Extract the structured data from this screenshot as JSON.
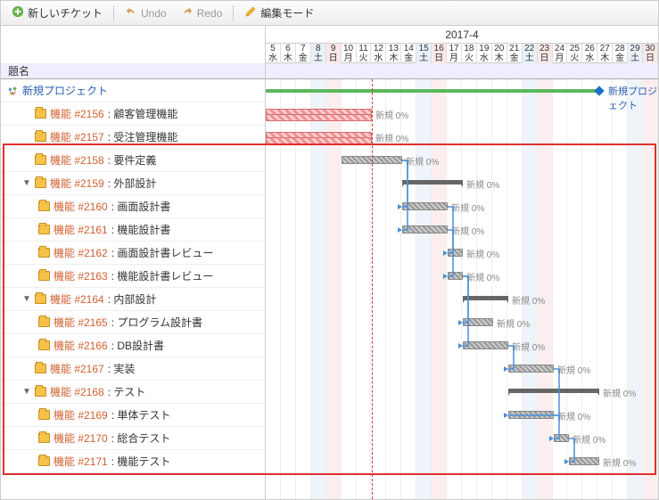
{
  "toolbar": {
    "new_ticket": "新しいチケット",
    "undo": "Undo",
    "redo": "Redo",
    "edit_mode": "編集モード"
  },
  "header": {
    "month": "2017-4",
    "subject": "題名",
    "days": [
      {
        "n": "5",
        "w": "水",
        "t": ""
      },
      {
        "n": "6",
        "w": "木",
        "t": ""
      },
      {
        "n": "7",
        "w": "金",
        "t": ""
      },
      {
        "n": "8",
        "w": "土",
        "t": "sat"
      },
      {
        "n": "9",
        "w": "日",
        "t": "sun"
      },
      {
        "n": "10",
        "w": "月",
        "t": ""
      },
      {
        "n": "11",
        "w": "火",
        "t": ""
      },
      {
        "n": "12",
        "w": "水",
        "t": ""
      },
      {
        "n": "13",
        "w": "木",
        "t": ""
      },
      {
        "n": "14",
        "w": "金",
        "t": ""
      },
      {
        "n": "15",
        "w": "土",
        "t": "sat"
      },
      {
        "n": "16",
        "w": "日",
        "t": "sun"
      },
      {
        "n": "17",
        "w": "月",
        "t": ""
      },
      {
        "n": "18",
        "w": "火",
        "t": ""
      },
      {
        "n": "19",
        "w": "水",
        "t": ""
      },
      {
        "n": "20",
        "w": "木",
        "t": ""
      },
      {
        "n": "21",
        "w": "金",
        "t": ""
      },
      {
        "n": "22",
        "w": "土",
        "t": "sat"
      },
      {
        "n": "23",
        "w": "日",
        "t": "sun"
      },
      {
        "n": "24",
        "w": "月",
        "t": ""
      },
      {
        "n": "25",
        "w": "火",
        "t": ""
      },
      {
        "n": "26",
        "w": "水",
        "t": ""
      },
      {
        "n": "27",
        "w": "木",
        "t": ""
      },
      {
        "n": "28",
        "w": "金",
        "t": ""
      },
      {
        "n": "29",
        "w": "土",
        "t": "sat"
      },
      {
        "n": "30",
        "w": "日",
        "t": "sun"
      }
    ]
  },
  "status_label": "新規 0%",
  "project_name": "新規プロジェクト",
  "tasks": [
    {
      "id": "2156",
      "label": "機能 #2156",
      "name": "顧客管理機能",
      "indent": 1,
      "expand": null
    },
    {
      "id": "2157",
      "label": "機能 #2157",
      "name": "受注管理機能",
      "indent": 1,
      "expand": null
    },
    {
      "id": "2158",
      "label": "機能 #2158",
      "name": "要件定義",
      "indent": 1,
      "expand": null
    },
    {
      "id": "2159",
      "label": "機能 #2159",
      "name": "外部設計",
      "indent": 1,
      "expand": "open"
    },
    {
      "id": "2160",
      "label": "機能 #2160",
      "name": "画面設計書",
      "indent": 2,
      "expand": null
    },
    {
      "id": "2161",
      "label": "機能 #2161",
      "name": "機能設計書",
      "indent": 2,
      "expand": null
    },
    {
      "id": "2162",
      "label": "機能 #2162",
      "name": "画面設計書レビュー",
      "indent": 2,
      "expand": null
    },
    {
      "id": "2163",
      "label": "機能 #2163",
      "name": "機能設計書レビュー",
      "indent": 2,
      "expand": null
    },
    {
      "id": "2164",
      "label": "機能 #2164",
      "name": "内部設計",
      "indent": 1,
      "expand": "open"
    },
    {
      "id": "2165",
      "label": "機能 #2165",
      "name": "プログラム設計書",
      "indent": 2,
      "expand": null
    },
    {
      "id": "2166",
      "label": "機能 #2166",
      "name": "DB設計書",
      "indent": 2,
      "expand": null
    },
    {
      "id": "2167",
      "label": "機能 #2167",
      "name": "実装",
      "indent": 1,
      "expand": null
    },
    {
      "id": "2168",
      "label": "機能 #2168",
      "name": "テスト",
      "indent": 1,
      "expand": "open"
    },
    {
      "id": "2169",
      "label": "機能 #2169",
      "name": "単体テスト",
      "indent": 2,
      "expand": null
    },
    {
      "id": "2170",
      "label": "機能 #2170",
      "name": "総合テスト",
      "indent": 2,
      "expand": null
    },
    {
      "id": "2171",
      "label": "機能 #2171",
      "name": "機能テスト",
      "indent": 2,
      "expand": null
    }
  ],
  "chart_data": {
    "type": "gantt",
    "date_range": {
      "start": "2017-04-05",
      "end": "2017-04-30"
    },
    "today": "2017-04-12",
    "milestone": {
      "name": "新規プロジェクト",
      "start": "2017-04-05",
      "end": "2017-04-27"
    },
    "bars": [
      {
        "task": "2156",
        "start": "2017-04-05",
        "end": "2017-04-12",
        "style": "red",
        "status": "新規 0%"
      },
      {
        "task": "2157",
        "start": "2017-04-05",
        "end": "2017-04-12",
        "style": "red",
        "status": "新規 0%"
      },
      {
        "task": "2158",
        "start": "2017-04-10",
        "end": "2017-04-14",
        "style": "gray",
        "status": "新規 0%"
      },
      {
        "task": "2159",
        "start": "2017-04-14",
        "end": "2017-04-18",
        "style": "group",
        "status": "新規 0%"
      },
      {
        "task": "2160",
        "start": "2017-04-14",
        "end": "2017-04-17",
        "style": "gray",
        "status": "新規 0%"
      },
      {
        "task": "2161",
        "start": "2017-04-14",
        "end": "2017-04-17",
        "style": "gray",
        "status": "新規 0%"
      },
      {
        "task": "2162",
        "start": "2017-04-17",
        "end": "2017-04-18",
        "style": "gray",
        "status": "新規 0%"
      },
      {
        "task": "2163",
        "start": "2017-04-17",
        "end": "2017-04-18",
        "style": "gray",
        "status": "新規 0%"
      },
      {
        "task": "2164",
        "start": "2017-04-18",
        "end": "2017-04-21",
        "style": "group",
        "status": "新規 0%"
      },
      {
        "task": "2165",
        "start": "2017-04-18",
        "end": "2017-04-20",
        "style": "gray",
        "status": "新規 0%"
      },
      {
        "task": "2166",
        "start": "2017-04-18",
        "end": "2017-04-21",
        "style": "gray",
        "status": "新規 0%"
      },
      {
        "task": "2167",
        "start": "2017-04-21",
        "end": "2017-04-24",
        "style": "gray",
        "status": "新規 0%"
      },
      {
        "task": "2168",
        "start": "2017-04-21",
        "end": "2017-04-27",
        "style": "group",
        "status": "新規 0%"
      },
      {
        "task": "2169",
        "start": "2017-04-21",
        "end": "2017-04-24",
        "style": "gray",
        "status": "新規 0%"
      },
      {
        "task": "2170",
        "start": "2017-04-24",
        "end": "2017-04-25",
        "style": "gray",
        "status": "新規 0%"
      },
      {
        "task": "2171",
        "start": "2017-04-25",
        "end": "2017-04-27",
        "style": "gray",
        "status": "新規 0%"
      }
    ],
    "dependencies": [
      [
        "2158",
        "2160"
      ],
      [
        "2158",
        "2161"
      ],
      [
        "2160",
        "2162"
      ],
      [
        "2161",
        "2163"
      ],
      [
        "2163",
        "2165"
      ],
      [
        "2163",
        "2166"
      ],
      [
        "2166",
        "2167"
      ],
      [
        "2167",
        "2169"
      ],
      [
        "2169",
        "2170"
      ],
      [
        "2170",
        "2171"
      ]
    ]
  }
}
